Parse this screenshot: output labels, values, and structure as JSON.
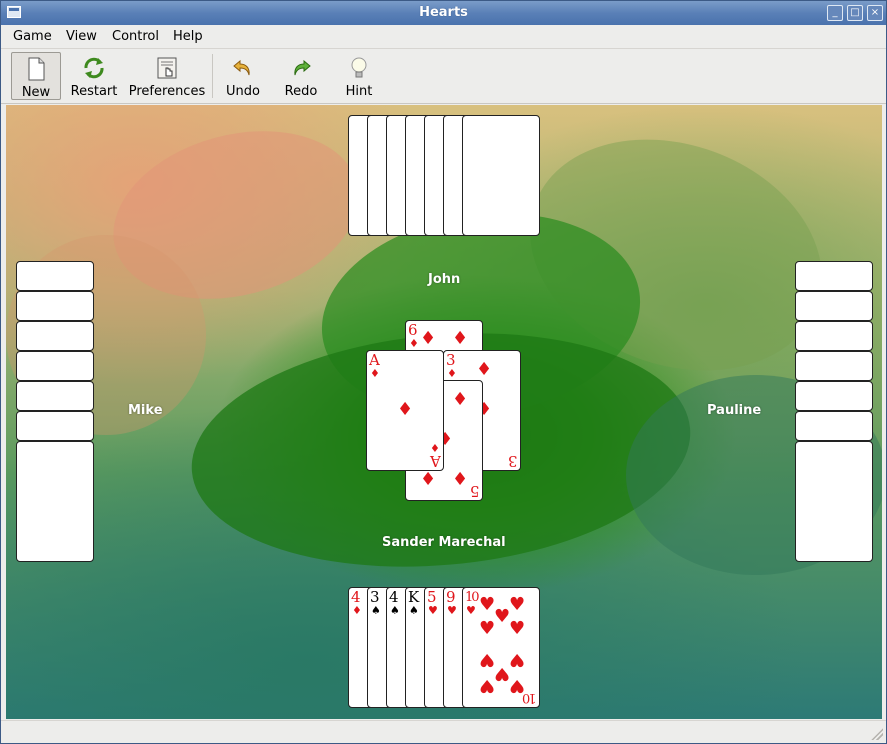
{
  "window": {
    "title": "Hearts"
  },
  "menubar": {
    "items": [
      "Game",
      "View",
      "Control",
      "Help"
    ]
  },
  "toolbar": {
    "new": "New",
    "restart": "Restart",
    "preferences": "Preferences",
    "undo": "Undo",
    "redo": "Redo",
    "hint": "Hint"
  },
  "players": {
    "north": "John",
    "west": "Mike",
    "east": "Pauline",
    "south": "Sander Marechal"
  },
  "trick": {
    "north": {
      "rank": "6",
      "suit": "♦"
    },
    "west": {
      "rank": "A",
      "suit": "♦"
    },
    "east": {
      "rank": "3",
      "suit": "♦"
    },
    "south": {
      "rank": "5",
      "suit": "♦"
    }
  },
  "hand": [
    {
      "rank": "4",
      "suit": "♦",
      "color": "red"
    },
    {
      "rank": "3",
      "suit": "♠",
      "color": "black"
    },
    {
      "rank": "4",
      "suit": "♠",
      "color": "black"
    },
    {
      "rank": "K",
      "suit": "♠",
      "color": "black"
    },
    {
      "rank": "5",
      "suit": "♥",
      "color": "red"
    },
    {
      "rank": "9",
      "suit": "♥",
      "color": "red"
    },
    {
      "rank": "10",
      "suit": "♥",
      "color": "red"
    }
  ],
  "colors": {
    "red_suit": "#e0161b",
    "titlebar": "#4a72ad",
    "felt_center": "#1d7d12"
  }
}
